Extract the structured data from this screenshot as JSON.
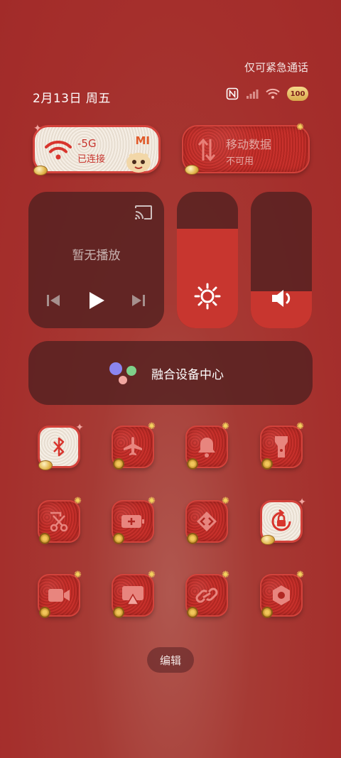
{
  "status": {
    "emergency_text": "仅可紧急通话",
    "date_text": "2月13日 周五",
    "battery_level": "100"
  },
  "wifi_tile": {
    "network": "-5G",
    "state": "已连接",
    "badge": "MI"
  },
  "data_tile": {
    "label": "移动数据",
    "state": "不可用"
  },
  "media": {
    "status": "暂无播放"
  },
  "brightness": {
    "level_percent": 73
  },
  "volume": {
    "level_percent": 27
  },
  "device_hub": {
    "label": "融合设备中心"
  },
  "edit_button": {
    "label": "编辑"
  },
  "colors": {
    "accent": "#c8362f",
    "panel": "#50201f",
    "background": "#a52f2c",
    "gold": "#e2b54b"
  },
  "toggles": [
    {
      "name": "bluetooth",
      "icon": "bluetooth-icon",
      "active": true
    },
    {
      "name": "airplane",
      "icon": "airplane-icon",
      "active": false
    },
    {
      "name": "silent",
      "icon": "bell-icon",
      "active": false
    },
    {
      "name": "flashlight",
      "icon": "flashlight-icon",
      "active": false
    },
    {
      "name": "screenshot",
      "icon": "scissors-icon",
      "active": false
    },
    {
      "name": "battery-saver",
      "icon": "battery-plus-icon",
      "active": false
    },
    {
      "name": "nearby-share",
      "icon": "share-arrows-icon",
      "active": false
    },
    {
      "name": "rotation-lock",
      "icon": "rotation-lock-icon",
      "active": true
    },
    {
      "name": "screen-record",
      "icon": "video-camera-icon",
      "active": false
    },
    {
      "name": "cast",
      "icon": "screen-cast-icon",
      "active": false
    },
    {
      "name": "link",
      "icon": "link-icon",
      "active": false
    },
    {
      "name": "settings",
      "icon": "hexagon-settings-icon",
      "active": false
    }
  ]
}
